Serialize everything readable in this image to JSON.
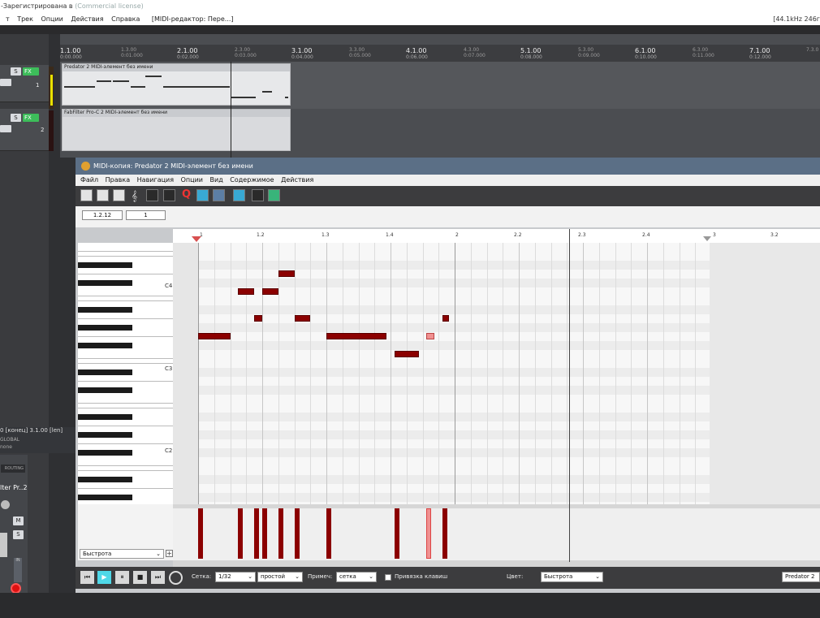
{
  "title_bar": {
    "text": "-Зарегистрирована в",
    "license": "(Commercial license)"
  },
  "menu": {
    "items": [
      "т",
      "Трек",
      "Опции",
      "Действия",
      "Справка"
    ],
    "midi_editor_tab": "[MIDI-редактор: Пере...]",
    "rate": "[44.1kHz 246г"
  },
  "ruler": {
    "bars": [
      {
        "label": "1.1.00",
        "time": "0:00.000"
      },
      {
        "label": "2.1.00",
        "time": "0:02.000"
      },
      {
        "label": "3.1.00",
        "time": "0:04.000"
      },
      {
        "label": "4.1.00",
        "time": "0:06.000"
      },
      {
        "label": "5.1.00",
        "time": "0:08.000"
      },
      {
        "label": "6.1.00",
        "time": "0:10.000"
      },
      {
        "label": "7.1.00",
        "time": "0:12.000"
      }
    ],
    "halves": [
      {
        "label": "1.3.00",
        "time": "0:01.000"
      },
      {
        "label": "2.3.00",
        "time": "0:03.000"
      },
      {
        "label": "3.3.00",
        "time": "0:05.000"
      },
      {
        "label": "4.3.00",
        "time": "0:07.000"
      },
      {
        "label": "5.3.00",
        "time": "0:09.000"
      },
      {
        "label": "6.3.00",
        "time": "0:11.000"
      },
      {
        "label": "7.3.0"
      }
    ]
  },
  "tracks": [
    {
      "s": "S",
      "fx": "FX",
      "num": "1",
      "item_label": "Predator 2 MIDI-элемент без имени"
    },
    {
      "s": "S",
      "fx": "FX",
      "num": "2",
      "item_label": "FabFilter Pro-C 2 MIDI-элемент без имени"
    }
  ],
  "left_panel": {
    "info": "0 [конец] 3.1.00 [len]",
    "global": "GLOBAL",
    "none": "none",
    "routing": "ROUTING",
    "track_name": "lter Pr..2",
    "m": "M",
    "s": "S",
    "in": "IN",
    "num": "2"
  },
  "midi_editor": {
    "title": "MIDI-копия: Predator 2 MIDI-элемент без имени",
    "menu": [
      "Файл",
      "Правка",
      "Навигация",
      "Опции",
      "Вид",
      "Содержимое",
      "Действия"
    ],
    "position": "1.2.12",
    "length": "1",
    "ruler_labels": [
      "1",
      "1.2",
      "1.3",
      "1.4",
      "2",
      "2.2",
      "2.3",
      "2.4",
      "3",
      "3.2"
    ],
    "key_labels": [
      "C4",
      "C3",
      "C2"
    ],
    "velocity_lane": "Быстрота",
    "bottom": {
      "grid_label": "Сетка:",
      "grid_value": "1/32",
      "grid_type": "простой",
      "notes_label": "Примеч:",
      "notes_value": "сетка",
      "snap_label": "Привязка клавиш",
      "color_label": "Цвет:",
      "color_value": "Быстрота",
      "instrument": "Predator 2"
    },
    "notes": [
      {
        "pitch": "G3",
        "start": 1.0,
        "len": 0.5
      },
      {
        "pitch": "C4",
        "start": 1.625,
        "len": 0.25
      },
      {
        "pitch": "A3",
        "start": 1.875,
        "len": 0.125
      },
      {
        "pitch": "C4",
        "start": 2.0,
        "len": 0.25
      },
      {
        "pitch": "D4",
        "start": 2.25,
        "len": 0.25
      },
      {
        "pitch": "A3",
        "start": 2.5,
        "len": 0.25
      },
      {
        "pitch": "G3",
        "start": 3.0,
        "len": 0.9375
      },
      {
        "pitch": "F3",
        "start": 4.0625,
        "len": 0.375
      },
      {
        "pitch": "G3",
        "start": 4.5625,
        "len": 0.125,
        "selected": true
      },
      {
        "pitch": "A3",
        "start": 4.8125,
        "len": 0.0625
      }
    ]
  }
}
